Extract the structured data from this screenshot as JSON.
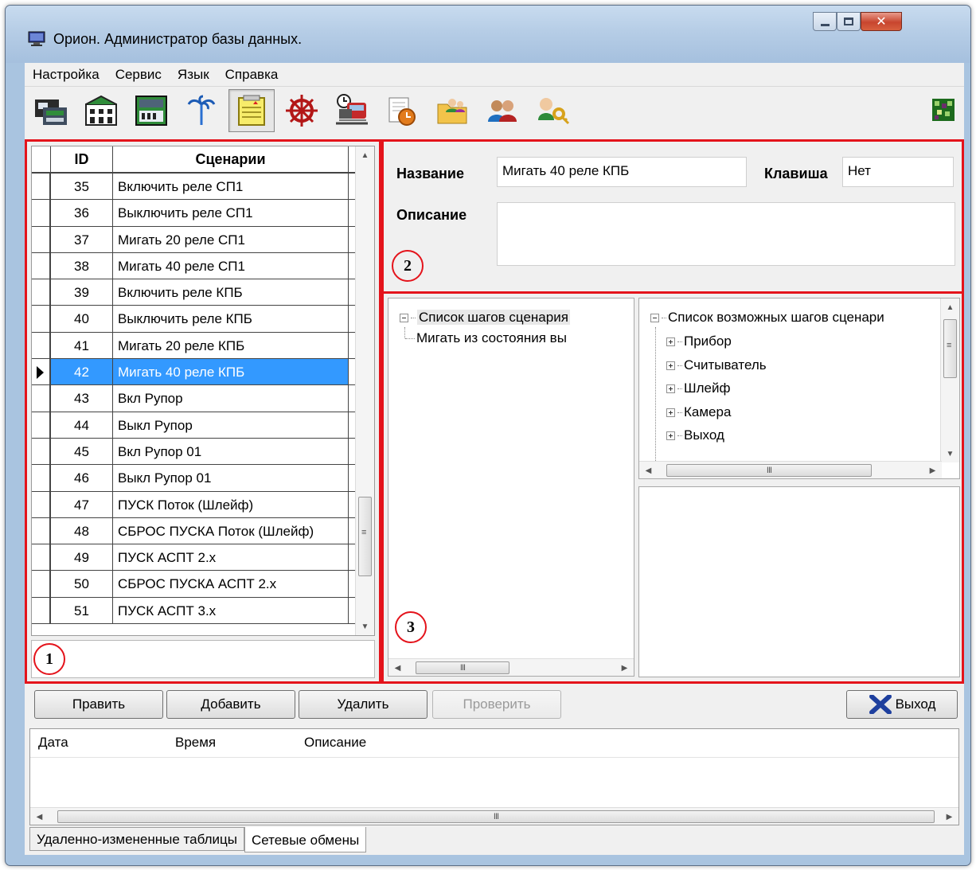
{
  "window": {
    "title": "Орион. Администратор базы данных."
  },
  "menu": [
    "Настройка",
    "Сервис",
    "Язык",
    "Справка"
  ],
  "toolbar": {
    "icons": [
      "devices-icon",
      "building-icon",
      "panel-icon",
      "palm-icon",
      "notepad-icon",
      "wheel-icon",
      "train-icon",
      "calendar-icon",
      "folder-users-icon",
      "users-icon",
      "keys-icon"
    ],
    "active_index": 4
  },
  "grid": {
    "headers": {
      "id": "ID",
      "name": "Сценарии"
    },
    "rows": [
      {
        "id": "35",
        "name": "Включить реле СП1"
      },
      {
        "id": "36",
        "name": "Выключить реле СП1"
      },
      {
        "id": "37",
        "name": "Мигать 20 реле СП1"
      },
      {
        "id": "38",
        "name": "Мигать 40 реле СП1"
      },
      {
        "id": "39",
        "name": "Включить реле КПБ"
      },
      {
        "id": "40",
        "name": "Выключить реле КПБ"
      },
      {
        "id": "41",
        "name": "Мигать 20 реле КПБ"
      },
      {
        "id": "42",
        "name": "Мигать 40 реле КПБ"
      },
      {
        "id": "43",
        "name": "Вкл Рупор"
      },
      {
        "id": "44",
        "name": "Выкл Рупор"
      },
      {
        "id": "45",
        "name": "Вкл Рупор 01"
      },
      {
        "id": "46",
        "name": "Выкл Рупор 01"
      },
      {
        "id": "47",
        "name": "ПУСК Поток (Шлейф)"
      },
      {
        "id": "48",
        "name": "СБРОС ПУСКА Поток (Шлейф)"
      },
      {
        "id": "49",
        "name": "ПУСК АСПТ 2.x"
      },
      {
        "id": "50",
        "name": "СБРОС ПУСКА АСПТ 2.x"
      },
      {
        "id": "51",
        "name": "ПУСК АСПТ 3.x"
      }
    ],
    "selected_index": 7
  },
  "annotations": {
    "one": "1",
    "two": "2",
    "three": "3"
  },
  "details": {
    "name_label": "Название",
    "name_value": "Мигать 40 реле КПБ",
    "key_label": "Клавиша",
    "key_value": "Нет",
    "desc_label": "Описание",
    "desc_value": ""
  },
  "steps_tree": {
    "root": "Список шагов сценария",
    "children": [
      "Мигать из состояния вы"
    ]
  },
  "possible_tree": {
    "root": "Список возможных шагов сценари",
    "children": [
      "Прибор",
      "Считыватель",
      "Шлейф",
      "Камера",
      "Выход"
    ]
  },
  "buttons": {
    "edit": "Править",
    "add": "Добавить",
    "delete": "Удалить",
    "check": "Проверить",
    "exit": "Выход"
  },
  "log": {
    "columns": [
      "Дата",
      "Время",
      "Описание"
    ]
  },
  "tabs": [
    "Удаленно-измененные таблицы",
    "Сетевые обмены"
  ],
  "colors": {
    "highlight": "#e4131b",
    "selection": "#3399ff"
  }
}
